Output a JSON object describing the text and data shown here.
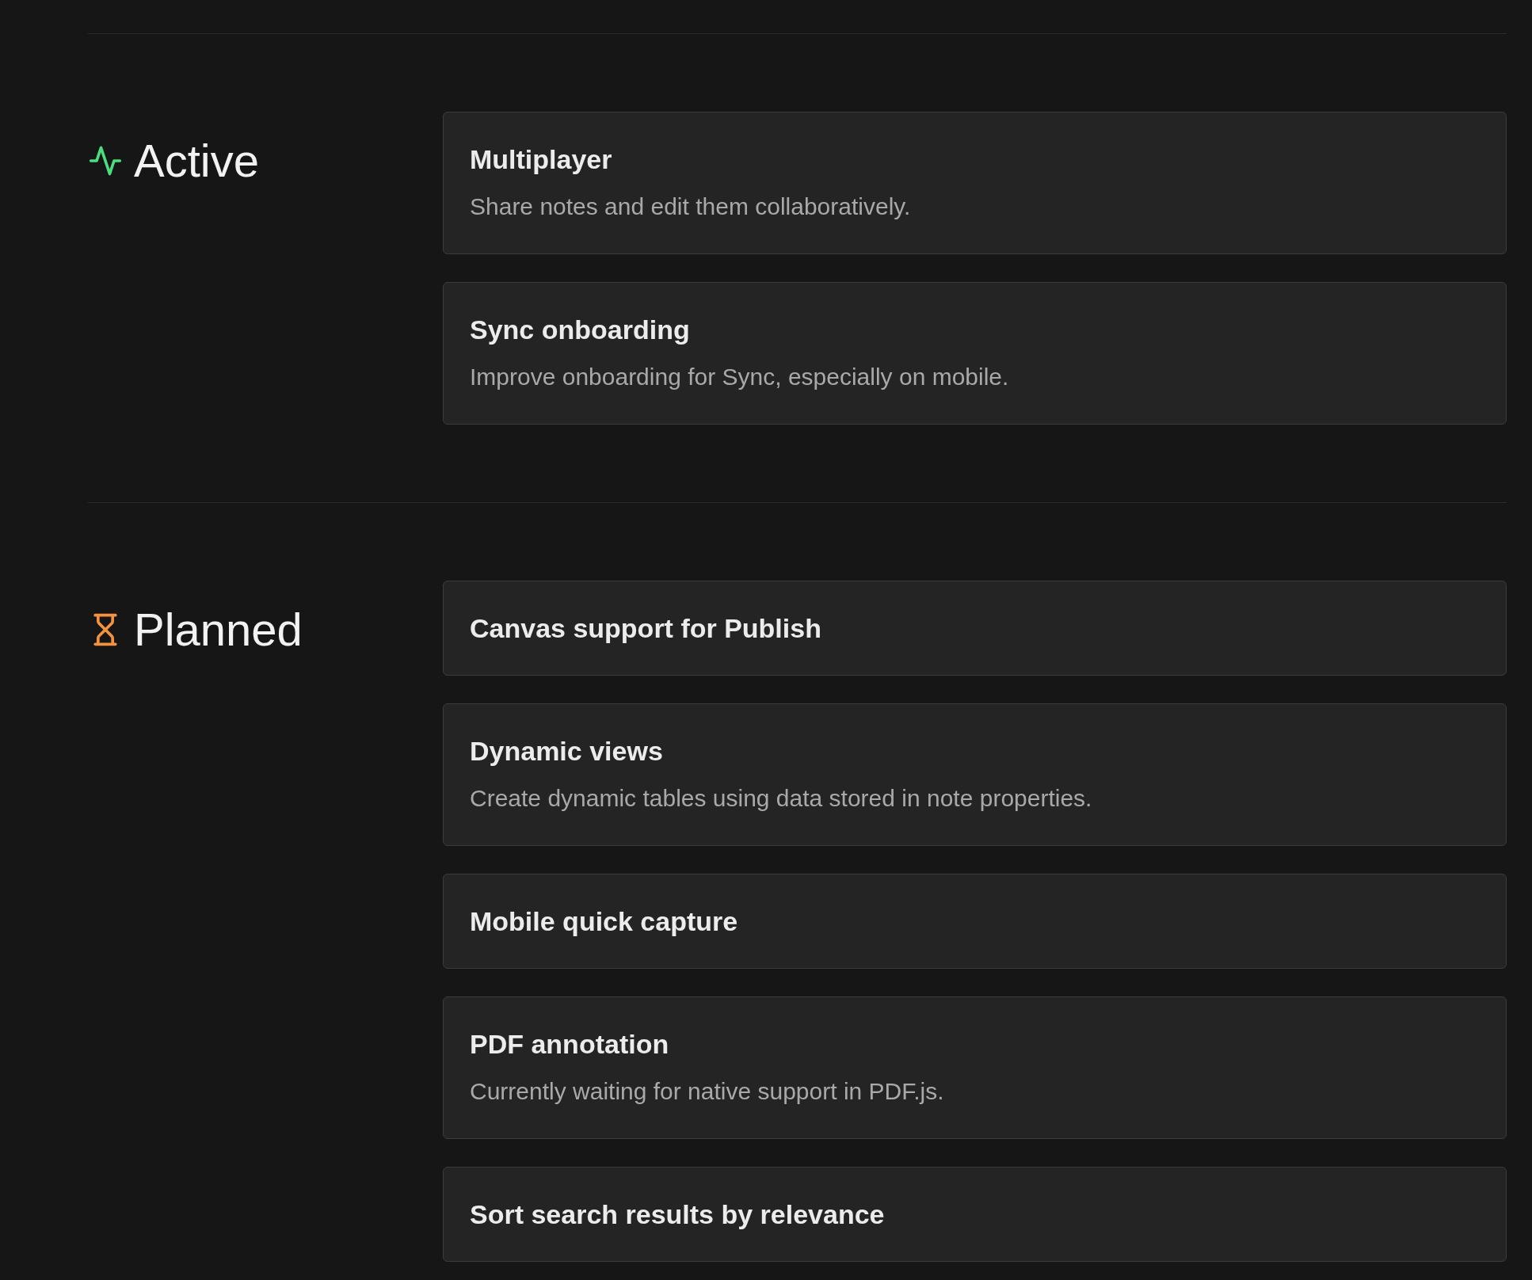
{
  "sections": [
    {
      "kind": "active",
      "title": "Active",
      "items": [
        {
          "title": "Multiplayer",
          "description": "Share notes and edit them collaboratively."
        },
        {
          "title": "Sync onboarding",
          "description": "Improve onboarding for Sync, especially on mobile."
        }
      ]
    },
    {
      "kind": "planned",
      "title": "Planned",
      "items": [
        {
          "title": "Canvas support for Publish"
        },
        {
          "title": "Dynamic views",
          "description": "Create dynamic tables using data stored in note properties."
        },
        {
          "title": "Mobile quick capture"
        },
        {
          "title": "PDF annotation",
          "description": "Currently waiting for native support in PDF.js."
        },
        {
          "title": "Sort search results by relevance"
        }
      ]
    }
  ]
}
